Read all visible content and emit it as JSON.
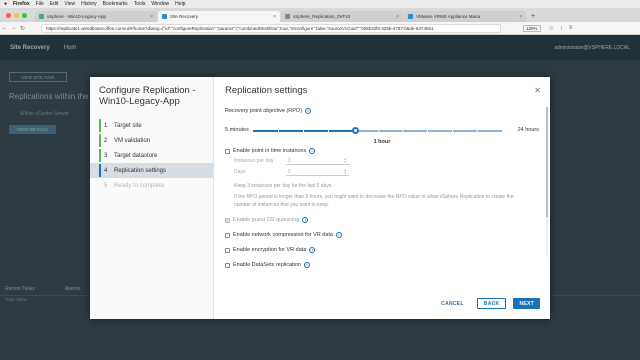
{
  "menubar": {
    "app": "Firefox",
    "items": [
      "File",
      "Edit",
      "View",
      "History",
      "Bookmarks",
      "Tools",
      "Window",
      "Help"
    ]
  },
  "tabs": [
    {
      "label": "vSphere - Win10-Legacy-App"
    },
    {
      "label": "Site Recovery"
    },
    {
      "label": "vSphere_Replication_0VF10"
    },
    {
      "label": "VMware VRMS Appliance Mana"
    }
  ],
  "url": {
    "text": "https://repliicate1.wiredbraincoffee.com/ui/#/home?dialog={\"id\":\"configureReplication\",\"params\":{\"combinedWorkflow\":true,\"reconfigure\":false,\"sourceVcGuid\":\"006b32f8-325b-4787-b5de-6374651",
    "zoom": "120%"
  },
  "app": {
    "brand": "Site Recovery",
    "home": "Hom",
    "header_right": "administrator@VSPHERE.LOCAL",
    "new_pair": "NEW SITE PAIR",
    "replications_title": "Replications within the",
    "replications_info": "Within vCenter Server",
    "view_details": "VIEW DETAILS",
    "bottom_tabs": [
      "Recent Tasks",
      "Alarms"
    ],
    "bottom_col": "Task Name"
  },
  "wizard": {
    "title": "Configure Replication - Win10-Legacy-App",
    "steps": [
      {
        "num": "1",
        "label": "Target site",
        "state": "done"
      },
      {
        "num": "2",
        "label": "VM validation",
        "state": "done"
      },
      {
        "num": "3",
        "label": "Target datastore",
        "state": "done"
      },
      {
        "num": "4",
        "label": "Replication settings",
        "state": "current"
      },
      {
        "num": "5",
        "label": "Ready to complete",
        "state": "disabled"
      }
    ]
  },
  "settings": {
    "title": "Replication settings",
    "rpo_label": "Recovery point objective (RPO)",
    "slider_min": "5 minutes",
    "slider_max": "24 hours",
    "slider_value": "1 hour",
    "slider_fraction": 0.41,
    "pit_label": "Enable point in time instances",
    "instances_label": "Instances per day",
    "instances_value": "3",
    "days_label": "Days",
    "days_value": "5",
    "hint1": "Keep 3 instances per day for the last 5 days.",
    "hint2": "If the RPO period is longer than 8 hours, you might want to decrease the RPO value to allow vSphere Replication to create the number of instances that you want to keep.",
    "quiesce_label": "Enable guest OS quiescing",
    "compression_label": "Enable network compression for VR data",
    "encryption_label": "Enable encryption for VR data",
    "datasets_label": "Enable DataSets replication"
  },
  "buttons": {
    "cancel": "CANCEL",
    "back": "BACK",
    "next": "NEXT"
  },
  "colors": {
    "accent": "#1a72b6",
    "step_done": "#5cb85c"
  }
}
